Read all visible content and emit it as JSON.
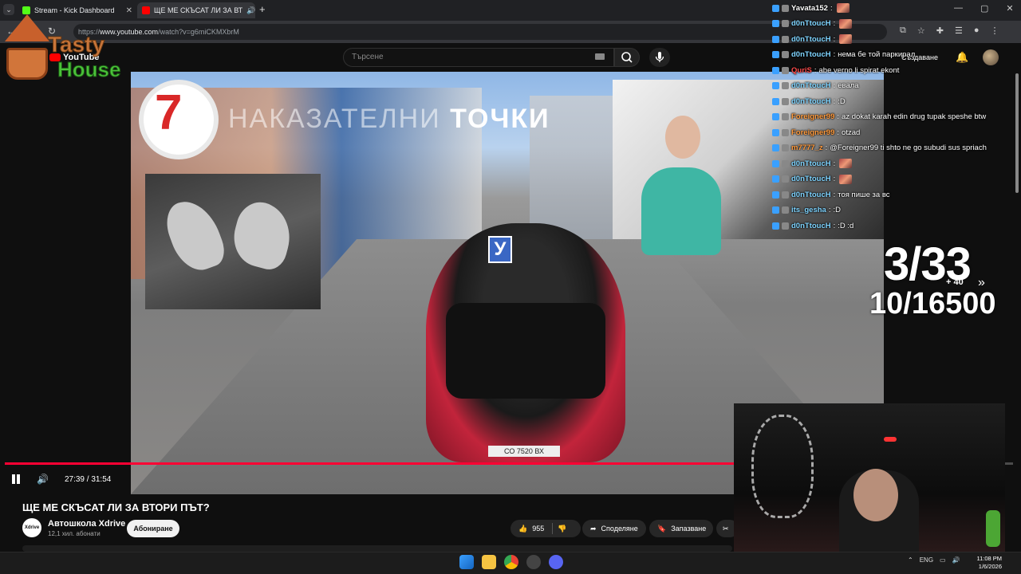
{
  "browser": {
    "tabs": [
      {
        "title": "Stream - Kick Dashboard"
      },
      {
        "title": "ЩЕ МЕ СКЪСАТ ЛИ ЗА ВТ"
      }
    ],
    "url_prefix": "https://",
    "url_host": "www.youtube.com",
    "url_path": "/watch?v=g6miCKMXbrM"
  },
  "youtube": {
    "logo": "YouTube",
    "search_placeholder": "Търсене",
    "create_label": "Създаване"
  },
  "video": {
    "lesson_number": "7",
    "lesson_title_thin": "НАКАЗАТЕЛНИ",
    "lesson_title_bold": "ТОЧКИ",
    "u_sign": "У",
    "plate": "СО 7520 ВХ",
    "progress_fraction": 0.873,
    "time": "27:39 / 31:54",
    "title": "ЩЕ МЕ СКЪСАТ ЛИ ЗА ВТОРИ ПЪТ?",
    "channel_name": "Автошкола Xdrive",
    "channel_avatar": "Xdrive",
    "subscribers": "12,1 хил. абонати",
    "subscribe_label": "Абониране",
    "likes": "955",
    "share_label": "Споделяне",
    "save_label": "Запазване"
  },
  "overlay": {
    "logo_line1": "Tasty",
    "logo_line2": "House",
    "counter_top": "3/33",
    "counter_bottom": "10/16500",
    "plus": "+ 40"
  },
  "chat": [
    {
      "user": "Yavata152",
      "msg": "",
      "color": "#ffffff",
      "emote": true
    },
    {
      "user": "d0nTtoucH",
      "msg": "",
      "color": "#7fd4ff",
      "emote": true
    },
    {
      "user": "d0nTtoucH",
      "msg": "",
      "color": "#7fd4ff",
      "emote": true
    },
    {
      "user": "d0nTtoucH",
      "msg": "нема бе той паркирал",
      "color": "#7fd4ff",
      "emote": false
    },
    {
      "user": "QuriS",
      "msg": "abe verno li spirat ekont",
      "color": "#ff4b4b",
      "emote": false
    },
    {
      "user": "d0nTtoucH",
      "msg": "евала",
      "color": "#7fd4ff",
      "emote": false
    },
    {
      "user": "d0nTtoucH",
      "msg": ":D",
      "color": "#7fd4ff",
      "emote": false
    },
    {
      "user": "Foreigner99",
      "msg": "az dokat karah edin drug tupak speshe btw",
      "color": "#ff9a3c",
      "emote": false
    },
    {
      "user": "Foreigner99",
      "msg": "otzad",
      "color": "#ff9a3c",
      "emote": false
    },
    {
      "user": "m7777_z",
      "msg": "@Foreigner99 ti shto ne go subudi sus spriach",
      "color": "#ff9a3c",
      "emote": false
    },
    {
      "user": "d0nTtoucH",
      "msg": "",
      "color": "#7fd4ff",
      "emote": true
    },
    {
      "user": "d0nTtoucH",
      "msg": "",
      "color": "#7fd4ff",
      "emote": true
    },
    {
      "user": "d0nTtoucH",
      "msg": "тоя пише за вс",
      "color": "#7fd4ff",
      "emote": false
    },
    {
      "user": "its_gesha",
      "msg": ":D",
      "color": "#7fd4ff",
      "emote": false
    },
    {
      "user": "d0nTtoucH",
      "msg": ":D :d",
      "color": "#7fd4ff",
      "emote": false
    }
  ],
  "taskbar": {
    "lang": "ENG",
    "time": "11:08 PM",
    "date": "1/6/2026"
  },
  "colors": {
    "accent": "#ff0033",
    "kick_green": "#53fc18",
    "chat_blue": "#7fd4ff"
  }
}
